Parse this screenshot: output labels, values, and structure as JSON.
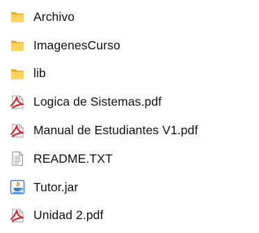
{
  "colors": {
    "folder": "#f5c13f",
    "folder_light": "#ffd86e",
    "pdf_red": "#d6262c",
    "text_icon_gray": "#8a8a8a",
    "jar_blue": "#3b7bd1",
    "jar_orange": "#e07b1f",
    "label_text": "#111111"
  },
  "files": [
    {
      "name": "Archivo",
      "type": "folder",
      "icon": "folder-icon"
    },
    {
      "name": "ImagenesCurso",
      "type": "folder",
      "icon": "folder-icon"
    },
    {
      "name": "lib",
      "type": "folder",
      "icon": "folder-icon"
    },
    {
      "name": "Logica de Sistemas.pdf",
      "type": "pdf",
      "icon": "pdf-icon"
    },
    {
      "name": "Manual de Estudiantes V1.pdf",
      "type": "pdf",
      "icon": "pdf-icon"
    },
    {
      "name": "README.TXT",
      "type": "text",
      "icon": "text-file-icon"
    },
    {
      "name": "Tutor.jar",
      "type": "jar",
      "icon": "java-jar-icon"
    },
    {
      "name": "Unidad 2.pdf",
      "type": "pdf",
      "icon": "pdf-icon"
    }
  ]
}
